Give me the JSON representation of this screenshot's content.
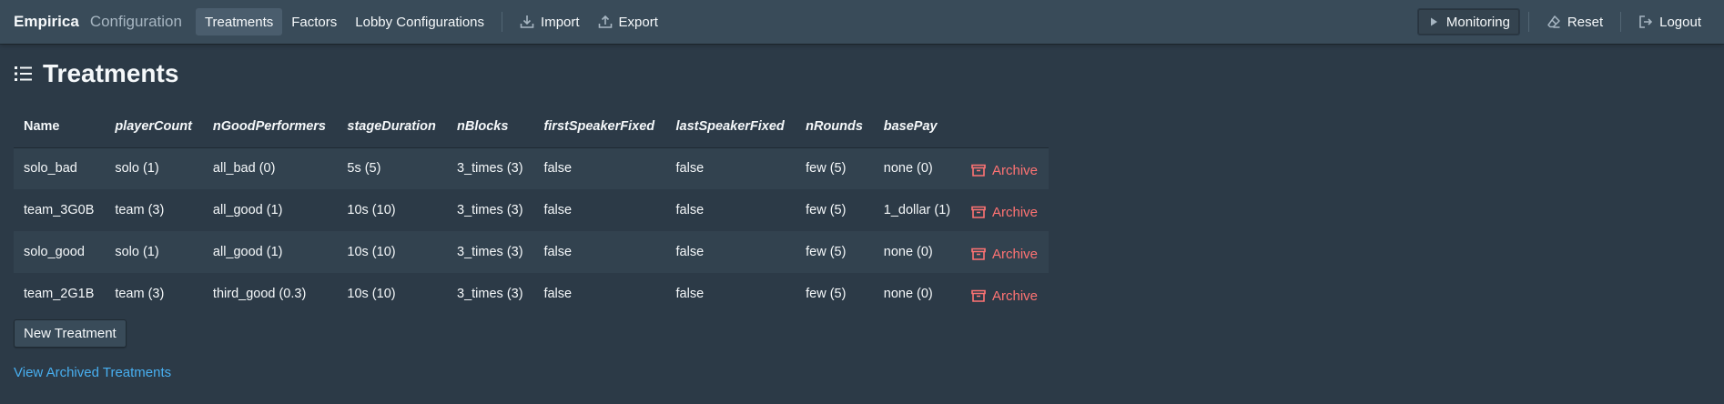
{
  "navbar": {
    "brand": "Empirica",
    "subbrand": "Configuration",
    "tabs": [
      {
        "label": "Treatments",
        "active": true
      },
      {
        "label": "Factors",
        "active": false
      },
      {
        "label": "Lobby Configurations",
        "active": false
      }
    ],
    "import_label": "Import",
    "export_label": "Export",
    "monitoring_label": "Monitoring",
    "reset_label": "Reset",
    "logout_label": "Logout"
  },
  "page": {
    "title": "Treatments",
    "title_icon": "list-icon"
  },
  "table": {
    "columns": [
      "Name",
      "playerCount",
      "nGoodPerformers",
      "stageDuration",
      "nBlocks",
      "firstSpeakerFixed",
      "lastSpeakerFixed",
      "nRounds",
      "basePay"
    ],
    "rows": [
      {
        "cells": [
          "solo_bad",
          "solo (1)",
          "all_bad (0)",
          "5s (5)",
          "3_times (3)",
          "false",
          "false",
          "few (5)",
          "none (0)"
        ],
        "action": "Archive"
      },
      {
        "cells": [
          "team_3G0B",
          "team (3)",
          "all_good (1)",
          "10s (10)",
          "3_times (3)",
          "false",
          "false",
          "few (5)",
          "1_dollar (1)"
        ],
        "action": "Archive"
      },
      {
        "cells": [
          "solo_good",
          "solo (1)",
          "all_good (1)",
          "10s (10)",
          "3_times (3)",
          "false",
          "false",
          "few (5)",
          "none (0)"
        ],
        "action": "Archive"
      },
      {
        "cells": [
          "team_2G1B",
          "team (3)",
          "third_good (0.3)",
          "10s (10)",
          "3_times (3)",
          "false",
          "false",
          "few (5)",
          "none (0)"
        ],
        "action": "Archive"
      }
    ]
  },
  "actions": {
    "new_treatment_label": "New Treatment",
    "view_archived_label": "View Archived Treatments"
  },
  "colors": {
    "background": "#2c3a47",
    "navbar": "#394b59",
    "danger": "#ff7373",
    "link": "#48aff0"
  }
}
